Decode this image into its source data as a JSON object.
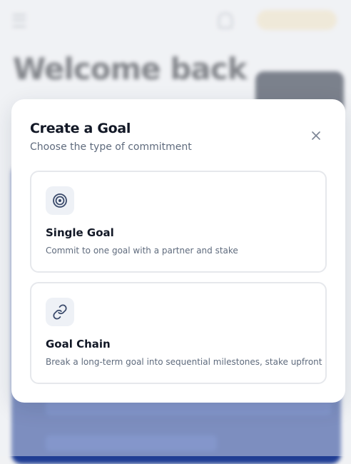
{
  "background": {
    "page_title": "Welcome back"
  },
  "modal": {
    "title": "Create a Goal",
    "subtitle": "Choose the type of commitment",
    "close_icon": "close-icon",
    "options": [
      {
        "icon": "target-icon",
        "title": "Single Goal",
        "description": "Commit to one goal with a partner and stake"
      },
      {
        "icon": "link-icon",
        "title": "Goal Chain",
        "description": "Break a long-term goal into sequential milestones, stake upfront"
      }
    ]
  },
  "colors": {
    "accent_dark": "#3a4a6b",
    "background_blue": "#1f3d93"
  }
}
